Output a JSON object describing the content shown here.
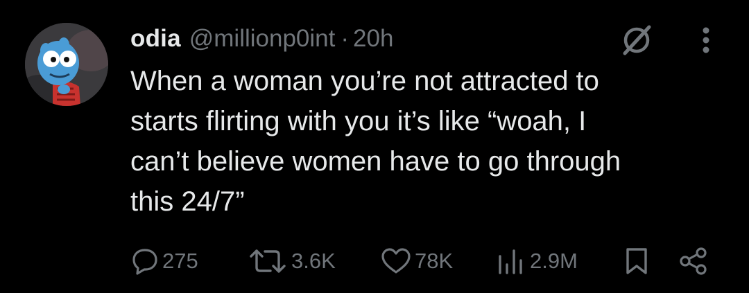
{
  "tweet": {
    "display_name": "odia",
    "handle": "@millionp0int",
    "separator": "·",
    "timestamp": "20h",
    "text": "When a woman you’re not attracted to\nstarts flirting with you it’s like “woah, I\ncan’t believe women have to go through\nthis 24/7”"
  },
  "actions": {
    "replies": "275",
    "retweets": "3.6K",
    "likes": "78K",
    "views": "2.9M"
  },
  "icons": {
    "grok": "grok-icon",
    "more": "more-icon",
    "reply": "reply-icon",
    "retweet": "retweet-icon",
    "like": "heart-icon",
    "views": "views-icon",
    "bookmark": "bookmark-icon",
    "share": "share-icon"
  },
  "colors": {
    "background": "#000000",
    "text": "#e7e9ea",
    "muted": "#71767b"
  }
}
